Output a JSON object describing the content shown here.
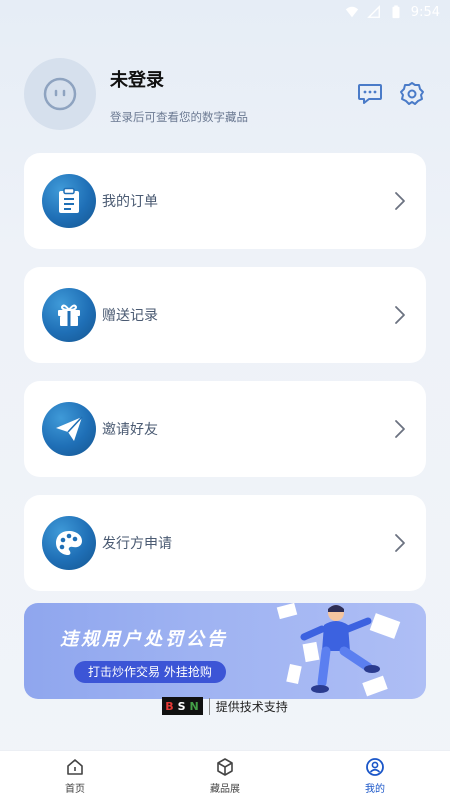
{
  "status_bar": {
    "time": "9:54"
  },
  "profile": {
    "name": "未登录",
    "hint": "登录后可查看您的数字藏品"
  },
  "header_icons": [
    "message-icon",
    "settings-icon"
  ],
  "menu": {
    "items": [
      {
        "label": "我的订单",
        "icon": "clipboard-icon"
      },
      {
        "label": "赠送记录",
        "icon": "gift-icon"
      },
      {
        "label": "邀请好友",
        "icon": "paper-plane-icon"
      },
      {
        "label": "发行方申请",
        "icon": "palette-icon"
      }
    ]
  },
  "banner": {
    "title": "违规用户处罚公告",
    "pill": "打击炒作交易 外挂抢购"
  },
  "footer_support": {
    "logo": "BSN",
    "text": "提供技术支持"
  },
  "tabbar": {
    "tabs": [
      {
        "label": "首页",
        "icon": "home-icon",
        "active": false
      },
      {
        "label": "藏品展",
        "icon": "cube-icon",
        "active": false
      },
      {
        "label": "我的",
        "icon": "user-icon",
        "active": true
      }
    ]
  },
  "colors": {
    "accent": "#1a56c8",
    "card_icon": "#1f6fb6",
    "banner_pill": "#3c55d6"
  }
}
